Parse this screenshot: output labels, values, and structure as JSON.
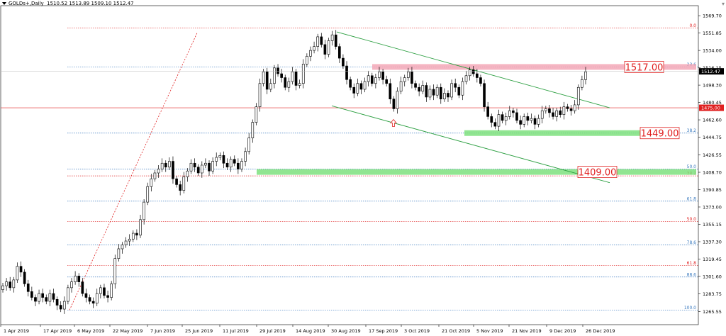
{
  "header": {
    "symbol": "GOLDs+,Daily",
    "ohlc": "1510.52 1513.89 1509.10 1512.47"
  },
  "corner_icon": "triangle-down-icon",
  "chart_data": {
    "type": "candlestick",
    "title": "GOLDs+,Daily",
    "ylim": [
      1252.0,
      1580.0
    ],
    "y_ticks": [
      "1569.70",
      "1551.85",
      "1534.00",
      "1516.15",
      "1498.30",
      "1480.45",
      "1462.60",
      "1444.75",
      "1426.55",
      "1408.70",
      "1390.85",
      "1373.00",
      "1355.15",
      "1337.30",
      "1319.45",
      "1301.60",
      "1283.75",
      "1265.55"
    ],
    "y_tick_values": [
      1569.7,
      1551.85,
      1534.0,
      1516.15,
      1498.3,
      1480.45,
      1462.6,
      1444.75,
      1426.55,
      1408.7,
      1390.85,
      1373.0,
      1355.15,
      1337.3,
      1319.45,
      1301.6,
      1283.75,
      1265.55
    ],
    "x_ticks": [
      "1 Apr 2019",
      "17 Apr 2019",
      "6 May 2019",
      "22 May 2019",
      "7 Jun 2019",
      "25 Jun 2019",
      "11 Jul 2019",
      "29 Jul 2019",
      "14 Aug 2019",
      "30 Aug 2019",
      "17 Sep 2019",
      "3 Oct 2019",
      "21 Oct 2019",
      "5 Nov 2019",
      "21 Nov 2019",
      "9 Dec 2019",
      "26 Dec 2019"
    ],
    "candle_close_path": [
      1292,
      1296,
      1290,
      1298,
      1312,
      1306,
      1294,
      1286,
      1280,
      1276,
      1284,
      1280,
      1276,
      1284,
      1278,
      1272,
      1268,
      1276,
      1290,
      1296,
      1302,
      1296,
      1284,
      1280,
      1276,
      1274,
      1284,
      1290,
      1282,
      1280,
      1294,
      1320,
      1330,
      1334,
      1338,
      1340,
      1346,
      1344,
      1360,
      1378,
      1394,
      1402,
      1408,
      1412,
      1418,
      1414,
      1420,
      1402,
      1396,
      1390,
      1404,
      1410,
      1418,
      1414,
      1408,
      1416,
      1418,
      1410,
      1420,
      1424,
      1426,
      1418,
      1414,
      1422,
      1418,
      1412,
      1420,
      1430,
      1444,
      1460,
      1476,
      1500,
      1512,
      1494,
      1500,
      1516,
      1510,
      1506,
      1496,
      1502,
      1512,
      1498,
      1500,
      1520,
      1528,
      1534,
      1538,
      1548,
      1540,
      1530,
      1544,
      1550,
      1538,
      1526,
      1518,
      1504,
      1496,
      1490,
      1500,
      1494,
      1502,
      1508,
      1500,
      1506,
      1512,
      1504,
      1500,
      1484,
      1474,
      1492,
      1502,
      1506,
      1512,
      1500,
      1496,
      1492,
      1498,
      1486,
      1494,
      1488,
      1496,
      1484,
      1490,
      1486,
      1500,
      1496,
      1488,
      1502,
      1508,
      1514,
      1510,
      1506,
      1500,
      1476,
      1466,
      1460,
      1456,
      1468,
      1462,
      1466,
      1472,
      1470,
      1462,
      1458,
      1466,
      1462,
      1464,
      1458,
      1464,
      1472,
      1474,
      1470,
      1466,
      1472,
      1468,
      1476,
      1474,
      1472,
      1478,
      1496,
      1504,
      1512
    ],
    "candles_shown": 160,
    "horizontal_lines": [
      {
        "label": "1475.00",
        "value": 1475.0,
        "color": "#e02020",
        "style": "solid"
      },
      {
        "label": "0.0",
        "value": 1557.0,
        "color": "#e02020",
        "style": "dotted"
      },
      {
        "label": "23.6",
        "value": 1517.0,
        "color": "#3a7abf",
        "style": "dotted"
      },
      {
        "label": "38.2",
        "value": 1449.0,
        "color": "#3a7abf",
        "style": "dotted"
      },
      {
        "label": "50.0",
        "value": 1412.0,
        "color": "#3a7abf",
        "style": "dotted"
      },
      {
        "label": "38.2",
        "value": 1405.0,
        "color": "#e02020",
        "style": "dotted"
      },
      {
        "label": "61.8",
        "value": 1379.0,
        "color": "#3a7abf",
        "style": "dotted"
      },
      {
        "label": "50.0",
        "value": 1358.0,
        "color": "#e02020",
        "style": "dotted"
      },
      {
        "label": "78.6",
        "value": 1334.0,
        "color": "#3a7abf",
        "style": "dotted"
      },
      {
        "label": "61.8",
        "value": 1313.0,
        "color": "#e02020",
        "style": "dotted"
      },
      {
        "label": "88.6",
        "value": 1301.0,
        "color": "#3a7abf",
        "style": "dotted"
      },
      {
        "label": "100.0",
        "value": 1267.0,
        "color": "#3a7abf",
        "style": "dotted"
      }
    ],
    "zones": [
      {
        "label": "1517.00",
        "value": 1517.0,
        "color": "#f3a8b7",
        "text_color": "#e02020"
      },
      {
        "label": "1449.00",
        "value": 1449.0,
        "color": "#7ee07e",
        "text_color": "#e02020"
      },
      {
        "label": "1409.00",
        "value": 1409.0,
        "color": "#7ee07e",
        "text_color": "#e02020"
      }
    ],
    "current_price_label": "1512.47",
    "current_price": 1512.47,
    "level_1475_label": "1475.00",
    "trend_channel": "descending",
    "marker": "up-arrow"
  }
}
